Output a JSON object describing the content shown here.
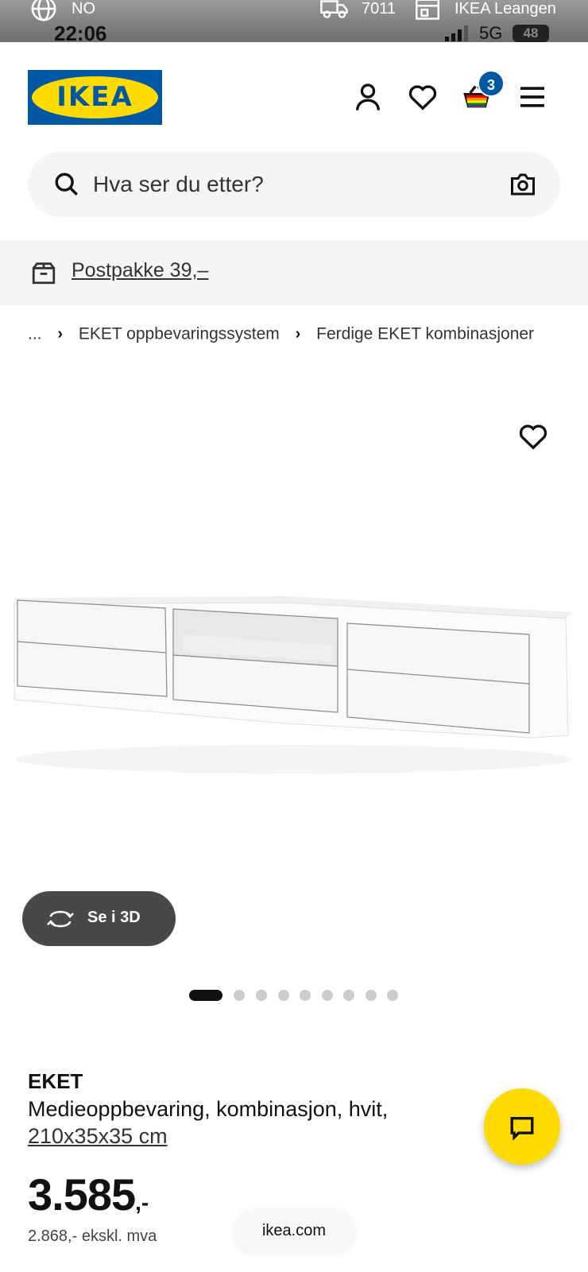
{
  "status_bar": {
    "language": "NO",
    "postal_code": "7011",
    "store": "IKEA Leangen",
    "time": "22:06",
    "network": "5G",
    "battery": "48"
  },
  "header": {
    "logo_text": "IKEA",
    "cart_count": "3",
    "icons": [
      "user-icon",
      "heart-icon",
      "cart-icon",
      "menu-icon"
    ]
  },
  "search": {
    "placeholder": "Hva ser du etter?"
  },
  "promo": {
    "label": "Postpakke 39,–"
  },
  "breadcrumb": {
    "ellipsis": "...",
    "items": [
      "EKET oppbevaringssystem",
      "Ferdige EKET kombinasjoner"
    ]
  },
  "gallery": {
    "view_3d_label": "Se i 3D",
    "image_count": 9,
    "active_index": 0
  },
  "product": {
    "name": "EKET",
    "description": "Medieoppbevaring, kombinasjon, hvit,",
    "size": "210x35x35 cm",
    "price_main": "3.585",
    "price_suffix": ",-",
    "price_excl_vat": "2.868,- ekskl. mva"
  },
  "browser": {
    "url": "ikea.com"
  },
  "colors": {
    "ikea_blue": "#0058a3",
    "ikea_yellow": "#ffdb00",
    "pill_dark": "#484848"
  }
}
